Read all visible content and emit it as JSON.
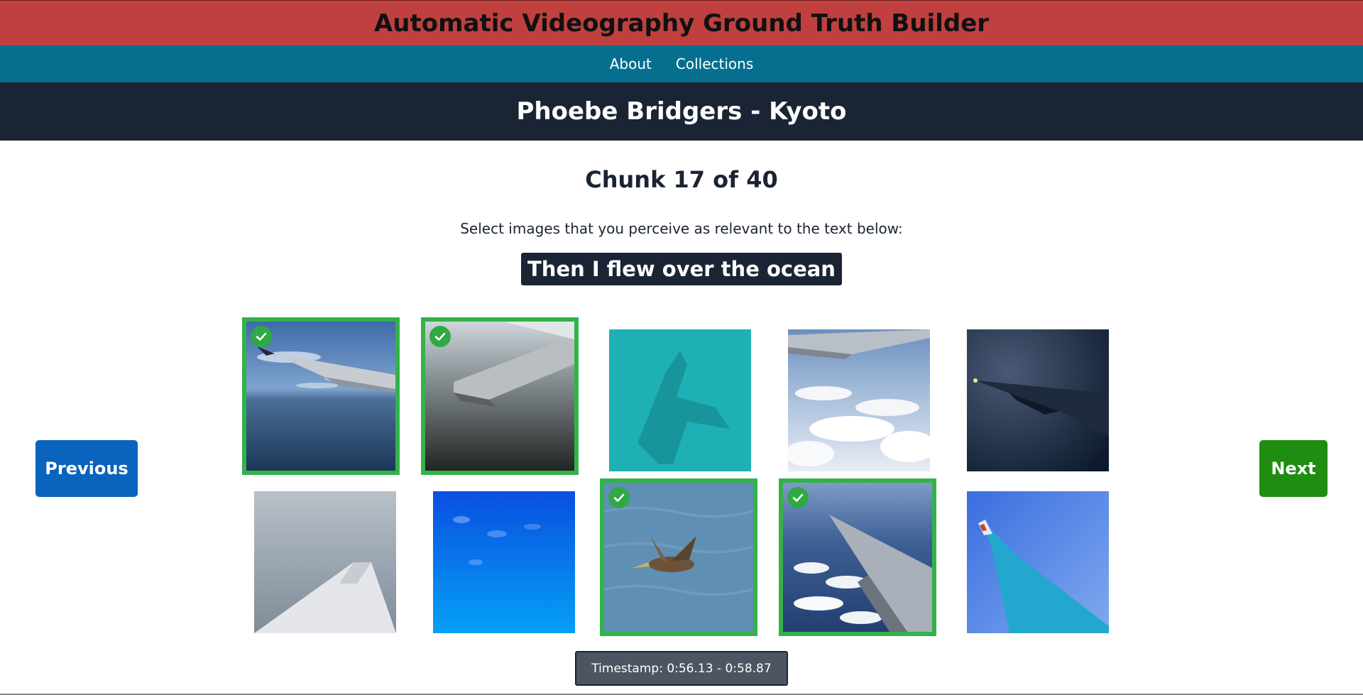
{
  "app": {
    "title": "Automatic Videography Ground Truth Builder"
  },
  "nav": {
    "items": [
      {
        "label": "About"
      },
      {
        "label": "Collections"
      }
    ]
  },
  "song": {
    "title": "Phoebe Bridgers - Kyoto"
  },
  "chunk": {
    "label": "Chunk 17 of 40",
    "current": 17,
    "total": 40
  },
  "instruction": "Select images that you perceive as relevant to the text below:",
  "lyric": "Then I flew over the ocean",
  "buttons": {
    "previous": "Previous",
    "next": "Next"
  },
  "images": [
    {
      "selected": true,
      "icon": "check-icon"
    },
    {
      "selected": true,
      "icon": "check-icon"
    },
    {
      "selected": false
    },
    {
      "selected": false
    },
    {
      "selected": false
    },
    {
      "selected": false
    },
    {
      "selected": false
    },
    {
      "selected": true,
      "icon": "check-icon"
    },
    {
      "selected": true,
      "icon": "check-icon"
    },
    {
      "selected": false
    }
  ],
  "timestamp": "Timestamp: 0:56.13 - 0:58.87",
  "colors": {
    "title_bar": "#c04040",
    "nav_bar": "#066f8f",
    "song_bar": "#1b2434",
    "previous_button": "#0a63bd",
    "next_button": "#1f8c12",
    "selected_border": "#33b24a"
  }
}
